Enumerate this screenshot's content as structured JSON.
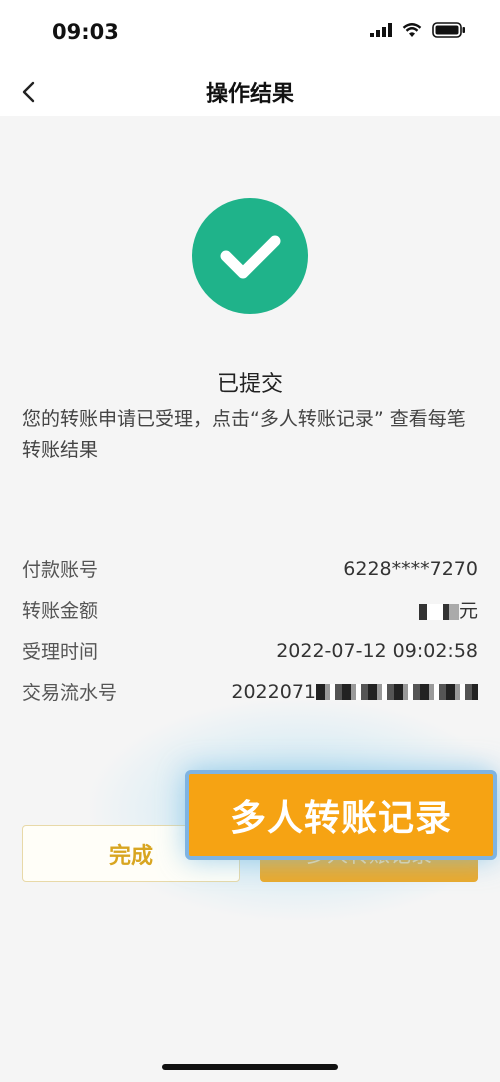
{
  "status_bar": {
    "time": "09:03"
  },
  "nav": {
    "title": "操作结果"
  },
  "result": {
    "title": "已提交",
    "description": "您的转账申请已受理，点击“多人转账记录” 查看每笔转账结果"
  },
  "info": [
    {
      "label": "付款账号",
      "value": "6228****7270"
    },
    {
      "label": "转账金额",
      "value_suffix": "元"
    },
    {
      "label": "受理时间",
      "value": "2022-07-12 09:02:58"
    },
    {
      "label": "交易流水号",
      "value_prefix": "2022071"
    }
  ],
  "buttons": {
    "done": "完成",
    "multi_records": "多人转账记录",
    "multi_records_zoomed": "多人转账记录"
  },
  "colors": {
    "success_green": "#1fb38a",
    "accent_orange": "#f6a313",
    "done_text": "#d8a520"
  }
}
